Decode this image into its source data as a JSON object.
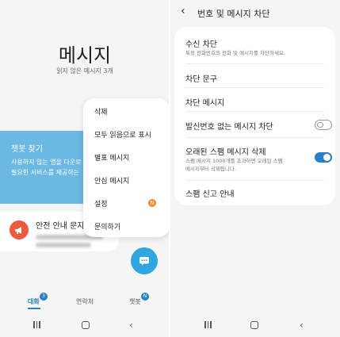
{
  "left": {
    "title": "메시지",
    "subtitle": "읽지 않은 메시지 3개",
    "chatbot_card": {
      "title": "챗봇 찾기",
      "desc_line1": "사용하지 않는 앱을 다운로",
      "desc_line2": "필요한 서비스를 제공하는"
    },
    "notice_card": {
      "title": "안전 안내 문자"
    },
    "context_menu": {
      "items": [
        "삭제",
        "모두 읽음으로 표시",
        "별표 메시지",
        "안심 메시지",
        "설정",
        "문의하기"
      ],
      "settings_badge": "N"
    },
    "tabs": [
      {
        "label": "대화",
        "badge": "3"
      },
      {
        "label": "연락처",
        "badge": ""
      },
      {
        "label": "챗봇",
        "badge": "N"
      }
    ]
  },
  "right": {
    "header_title": "번호 및 메시지 차단",
    "rows": [
      {
        "title": "수신 차단",
        "desc": "특정 전화번호의 전화 및 메시지를 차단하세요."
      },
      {
        "title": "차단 문구"
      },
      {
        "title": "차단 메시지"
      },
      {
        "title": "발신번호 없는 메시지 차단",
        "toggle": "off"
      },
      {
        "title": "오래된 스팸 메시지 삭제",
        "desc_line1": "스팸 메시지 1000개를 초과하면 오래된 스팸",
        "desc_line2": "메시지부터 삭제됩니다.",
        "toggle": "on"
      },
      {
        "title": "스팸 신고 안내"
      }
    ]
  },
  "colors": {
    "accent": "#2a7fc9",
    "chatbot_card": "#6bb8e2",
    "fab": "#2ea7e0",
    "notice_icon": "#f05a3c",
    "settings_badge": "#f08a2c"
  },
  "icons": [
    "back-arrow-icon",
    "megaphone-icon",
    "chat-fab-icon",
    "recent-apps-icon",
    "home-icon",
    "back-icon"
  ]
}
